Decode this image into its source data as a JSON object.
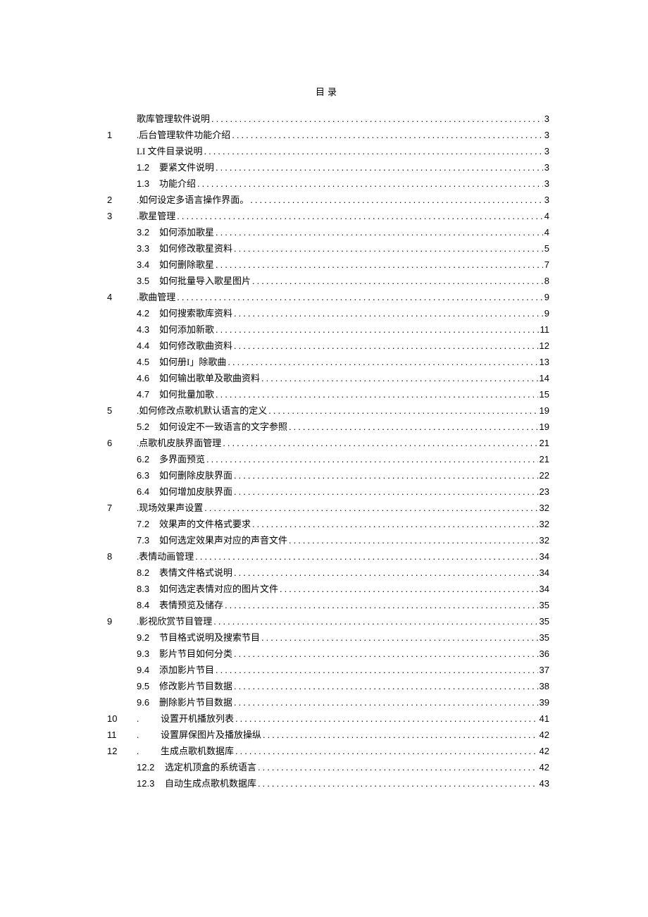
{
  "title": "目录",
  "entries": [
    {
      "level": 1,
      "num": "",
      "sub": "",
      "label": "歌库管理软件说明",
      "page": "3"
    },
    {
      "level": 0,
      "num": "1",
      "sub": "",
      "label": ".后台管理软件功能介绍",
      "page": "3"
    },
    {
      "level": 1,
      "num": "",
      "sub": "",
      "label": "LI 文件目录说明",
      "page": "3"
    },
    {
      "level": 1,
      "num": "",
      "sub": "1.2",
      "label": "要紧文件说明",
      "page": "3"
    },
    {
      "level": 1,
      "num": "",
      "sub": "1.3",
      "label": "功能介绍",
      "page": "3"
    },
    {
      "level": 0,
      "num": "2",
      "sub": "",
      "label": ".如何设定多语言操作界面。",
      "page": "3"
    },
    {
      "level": 0,
      "num": "3",
      "sub": "",
      "label": ".歌星管理",
      "page": "4"
    },
    {
      "level": 1,
      "num": "",
      "sub": "3.2",
      "label": "如何添加歌星",
      "page": "4"
    },
    {
      "level": 1,
      "num": "",
      "sub": "3.3",
      "label": "如何修改歌星资料",
      "page": "5"
    },
    {
      "level": 1,
      "num": "",
      "sub": "3.4",
      "label": "如何删除歌星",
      "page": "7"
    },
    {
      "level": 1,
      "num": "",
      "sub": "3.5",
      "label": "如何批量导入歌星图片",
      "page": "8"
    },
    {
      "level": 0,
      "num": "4",
      "sub": "",
      "label": ".歌曲管理",
      "page": "9"
    },
    {
      "level": 1,
      "num": "",
      "sub": "4.2",
      "label": "如何搜索歌库资料",
      "page": "9"
    },
    {
      "level": 1,
      "num": "",
      "sub": "4.3",
      "label": "如何添加新歌",
      "page": "11"
    },
    {
      "level": 1,
      "num": "",
      "sub": "4.4",
      "label": "如何修改歌曲资料",
      "page": "12"
    },
    {
      "level": 1,
      "num": "",
      "sub": "4.5",
      "label": "如何册I」除歌曲",
      "page": "13"
    },
    {
      "level": 1,
      "num": "",
      "sub": "4.6",
      "label": "如何输出歌单及歌曲资料",
      "page": "14"
    },
    {
      "level": 1,
      "num": "",
      "sub": "4.7",
      "label": "如何批量加歌",
      "page": "15"
    },
    {
      "level": 0,
      "num": "5",
      "sub": "",
      "label": ".如何修改点歌机默认语言的定义",
      "page": "19"
    },
    {
      "level": 1,
      "num": "",
      "sub": "5.2",
      "label": "如何设定不一致语言的文字参照",
      "page": "19"
    },
    {
      "level": 0,
      "num": "6",
      "sub": "",
      "label": ".点歌机皮肤界面管理",
      "page": "21"
    },
    {
      "level": 1,
      "num": "",
      "sub": "6.2",
      "label": "多界面预览",
      "page": "21"
    },
    {
      "level": 1,
      "num": "",
      "sub": "6.3",
      "label": "如何删除皮肤界面",
      "page": "22"
    },
    {
      "level": 1,
      "num": "",
      "sub": "6.4",
      "label": "如何增加皮肤界面",
      "page": "23"
    },
    {
      "level": 0,
      "num": "7",
      "sub": "",
      "label": ".现场效果声设置",
      "page": "32"
    },
    {
      "level": 1,
      "num": "",
      "sub": "7.2",
      "label": "效果声的文件格式要求",
      "page": "32"
    },
    {
      "level": 1,
      "num": "",
      "sub": "7.3",
      "label": "如何选定效果声对应的声音文件",
      "page": "32"
    },
    {
      "level": 0,
      "num": "8",
      "sub": "",
      "label": ".表情动画管理",
      "page": "34"
    },
    {
      "level": 1,
      "num": "",
      "sub": "8.2",
      "label": "表情文件格式说明",
      "page": "34"
    },
    {
      "level": 1,
      "num": "",
      "sub": "8.3",
      "label": "如何选定表情对应的图片文件",
      "page": "34"
    },
    {
      "level": 1,
      "num": "",
      "sub": "8.4",
      "label": "表情预览及储存",
      "page": "35"
    },
    {
      "level": 0,
      "num": "9",
      "sub": "",
      "label": ".影视欣赏节目管理",
      "page": "35"
    },
    {
      "level": 1,
      "num": "",
      "sub": "9.2",
      "label": "节目格式说明及搜索节目",
      "page": "35"
    },
    {
      "level": 1,
      "num": "",
      "sub": "9.3",
      "label": "影片节目如何分类",
      "page": "36"
    },
    {
      "level": 1,
      "num": "",
      "sub": "9.4",
      "label": "添加影片节目",
      "page": "37"
    },
    {
      "level": 1,
      "num": "",
      "sub": "9.5",
      "label": "修改影片节目数据",
      "page": "38"
    },
    {
      "level": 1,
      "num": "",
      "sub": "9.6",
      "label": "删除影片节目数据",
      "page": "39"
    },
    {
      "level": 0,
      "num": "10",
      "sub": ".",
      "label": "设置开机播放列表",
      "page": "41"
    },
    {
      "level": 0,
      "num": "11",
      "sub": ".",
      "label": "设置屏保图片及播放操纵",
      "page": "42"
    },
    {
      "level": 0,
      "num": "12",
      "sub": ".",
      "label": "生成点歌机数据库",
      "page": "42"
    },
    {
      "level": 1,
      "num": "",
      "sub": "12.2",
      "label": "选定机顶盒的系统语言",
      "page": "42"
    },
    {
      "level": 1,
      "num": "",
      "sub": "12.3",
      "label": "自动生成点歌机数据库",
      "page": "43"
    }
  ]
}
